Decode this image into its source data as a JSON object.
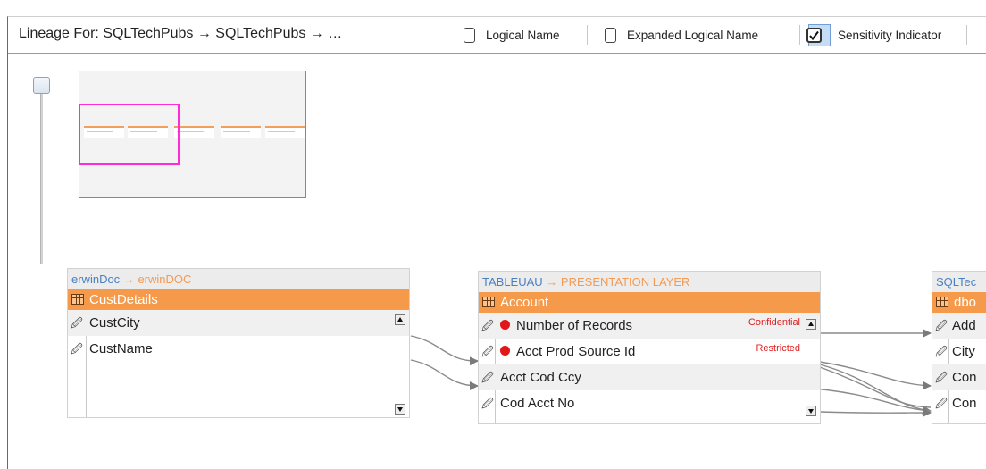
{
  "header": {
    "title": "Lineage For: SQLTechPubs → SQLTechPubs → …",
    "options": [
      {
        "label": "Logical Name",
        "checked": false
      },
      {
        "label": "Expanded Logical Name",
        "checked": false
      },
      {
        "label": "Sensitivity Indicator",
        "checked": true
      }
    ]
  },
  "cards": [
    {
      "crumb_source": "erwinDoc",
      "crumb_arrow": "→",
      "crumb_target": "erwinDOC",
      "table": "CustDetails",
      "rows": [
        {
          "name": "CustCity",
          "sensitivity": ""
        },
        {
          "name": "CustName",
          "sensitivity": ""
        }
      ]
    },
    {
      "crumb_source": "TABLEUAU",
      "crumb_arrow": "→",
      "crumb_target": "PRESENTATION LAYER",
      "table": "Account",
      "rows": [
        {
          "name": "Number of Records",
          "sensitivity": "Confidential"
        },
        {
          "name": "Acct Prod Source Id",
          "sensitivity": "Restricted"
        },
        {
          "name": "Acct Cod Ccy",
          "sensitivity": ""
        },
        {
          "name": "Cod Acct No",
          "sensitivity": ""
        }
      ]
    },
    {
      "crumb_source": "SQLTec",
      "table": "dbo",
      "rows": [
        {
          "name": "Add"
        },
        {
          "name": "City"
        },
        {
          "name": "Con"
        },
        {
          "name": "Con"
        }
      ]
    }
  ],
  "colors": {
    "table_header": "#f59a4a",
    "crumb_source": "#4a7fc1",
    "crumb_target": "#f59a52",
    "sensitivity": "#e21818",
    "minimap_viewport": "#ff2bd6"
  }
}
